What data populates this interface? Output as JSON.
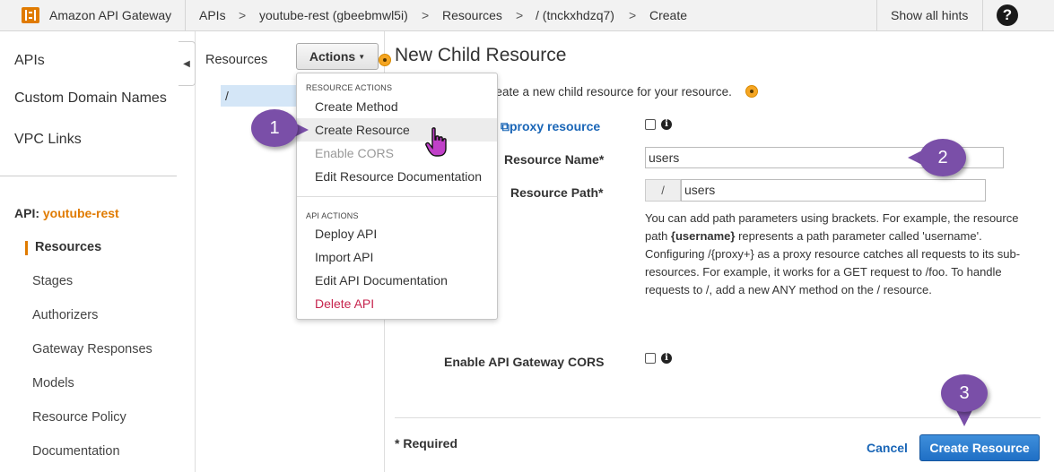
{
  "header": {
    "app_title": "Amazon API Gateway",
    "breadcrumbs": [
      "APIs",
      "youtube-rest (gbeebmwl5i)",
      "Resources",
      "/ (tnckxhdzq7)",
      "Create"
    ],
    "crumb_separator": ">",
    "show_hints": "Show all hints",
    "help_glyph": "?"
  },
  "sidebar": {
    "top_items": [
      "APIs",
      "Custom Domain Names",
      "VPC Links"
    ],
    "api_prefix": "API:",
    "api_name": "youtube-rest",
    "api_items": [
      "Resources",
      "Stages",
      "Authorizers",
      "Gateway Responses",
      "Models",
      "Resource Policy",
      "Documentation"
    ],
    "active_item": "Resources"
  },
  "resources_panel": {
    "title": "Resources",
    "actions_label": "Actions",
    "tree": [
      "/"
    ]
  },
  "actions_menu": {
    "resource_group": "RESOURCE ACTIONS",
    "resource_items": [
      "Create Method",
      "Create Resource",
      "Enable CORS",
      "Edit Resource Documentation"
    ],
    "api_group": "API ACTIONS",
    "api_items": [
      "Deploy API",
      "Import API",
      "Edit API Documentation",
      "Delete API"
    ]
  },
  "form": {
    "title": "New Child Resource",
    "intro": "reate a new child resource for your resource.",
    "proxy_label": "proxy resource",
    "resource_name_label": "Resource Name*",
    "resource_name_value": "users",
    "resource_path_label": "Resource Path*",
    "path_prefix": "/",
    "resource_path_value": "users",
    "help_pre": "You can add path parameters using brackets. For example, the resource path ",
    "help_bold": "{username}",
    "help_post": " represents a path parameter called 'username'. Configuring /{proxy+} as a proxy resource catches all requests to its sub-resources. For example, it works for a GET request to /foo. To handle requests to /, add a new ANY method on the / resource.",
    "cors_label": "Enable API Gateway CORS",
    "required_note": "* Required",
    "cancel_label": "Cancel",
    "submit_label": "Create Resource"
  },
  "callouts": [
    "1",
    "2",
    "3"
  ],
  "colors": {
    "accent_orange": "#e07b00",
    "link_blue": "#1a66b7",
    "primary_button": "#1f6fc5",
    "callout_purple": "#7a4fa8",
    "danger": "#c7254e"
  }
}
